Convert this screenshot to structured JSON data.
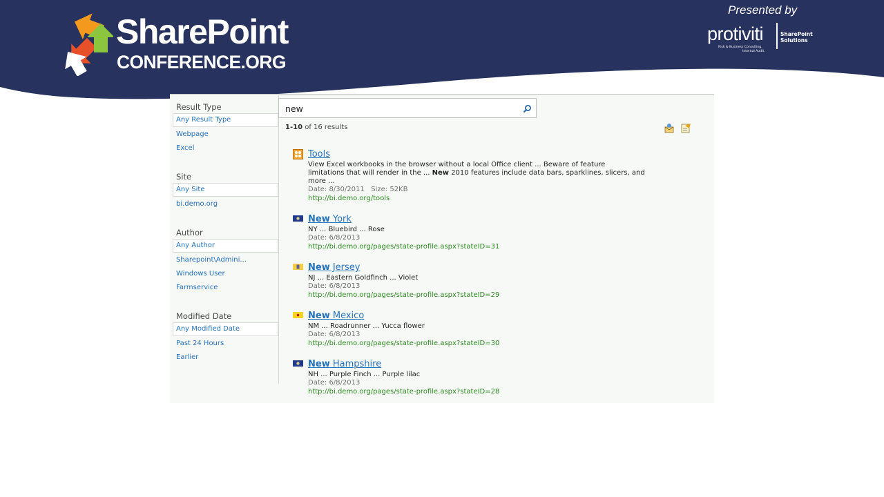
{
  "header": {
    "brand_title": "SharePoint",
    "brand_subtitle": "CONFERENCE.ORG",
    "presented_by": "Presented by",
    "sponsor": {
      "name": "protiviti",
      "tagline_line1": "Risk & Business Consulting.",
      "tagline_line2": "Internal Audit.",
      "unit_line1": "SharePoint",
      "unit_line2": "Solutions"
    },
    "colors": {
      "navy": "#27325e",
      "orange": "#f39a1e",
      "red": "#e8502a",
      "green": "#8cc63f"
    }
  },
  "search": {
    "query": "new",
    "icon": "magnifier-icon",
    "count_range": "1-10",
    "count_suffix": " of 16 results",
    "toolbar_icons": [
      "alert-me-icon",
      "rss-feed-icon"
    ]
  },
  "refiners": [
    {
      "heading": "Result Type",
      "selected": "Any Result Type",
      "items": [
        "Webpage",
        "Excel"
      ]
    },
    {
      "heading": "Site",
      "selected": "Any Site",
      "items": [
        "bi.demo.org"
      ]
    },
    {
      "heading": "Author",
      "selected": "Any Author",
      "items": [
        "Sharepoint\\Admini...",
        "Windows User",
        "Farmservice"
      ]
    },
    {
      "heading": "Modified Date",
      "selected": "Any Modified Date",
      "items": [
        "Past 24 Hours",
        "Earlier"
      ]
    }
  ],
  "results": [
    {
      "title_bold": "",
      "title": "Tools",
      "icon": "excel-workbook-icon",
      "line1": "View Excel workbooks in the browser without a local Office client ... Beware of feature",
      "line2_pre": "limitations that will render in the ... ",
      "line2_bold": "New",
      "line2_post": " 2010 features include data bars, sparklines, slicers, and",
      "line3": "more ...",
      "meta": "Date: 8/30/2011   Size: 52KB",
      "url": "http://bi.demo.org/tools"
    },
    {
      "title_bold": "New",
      "title": " York",
      "icon": "new-york-flag-icon",
      "line1": "NY ... Bluebird ... Rose",
      "meta": "Date: 6/8/2013",
      "url": "http://bi.demo.org/pages/state-profile.aspx?stateID=31"
    },
    {
      "title_bold": "New",
      "title": " Jersey",
      "icon": "new-jersey-flag-icon",
      "line1": "NJ ... Eastern Goldfinch ... Violet",
      "meta": "Date: 6/8/2013",
      "url": "http://bi.demo.org/pages/state-profile.aspx?stateID=29"
    },
    {
      "title_bold": "New",
      "title": " Mexico",
      "icon": "new-mexico-flag-icon",
      "line1": "NM ... Roadrunner ... Yucca flower",
      "meta": "Date: 6/8/2013",
      "url": "http://bi.demo.org/pages/state-profile.aspx?stateID=30"
    },
    {
      "title_bold": "New",
      "title": " Hampshire",
      "icon": "new-hampshire-flag-icon",
      "line1": "NH ... Purple Finch ... Purple lilac",
      "meta": "Date: 6/8/2013",
      "url": "http://bi.demo.org/pages/state-profile.aspx?stateID=28"
    }
  ]
}
